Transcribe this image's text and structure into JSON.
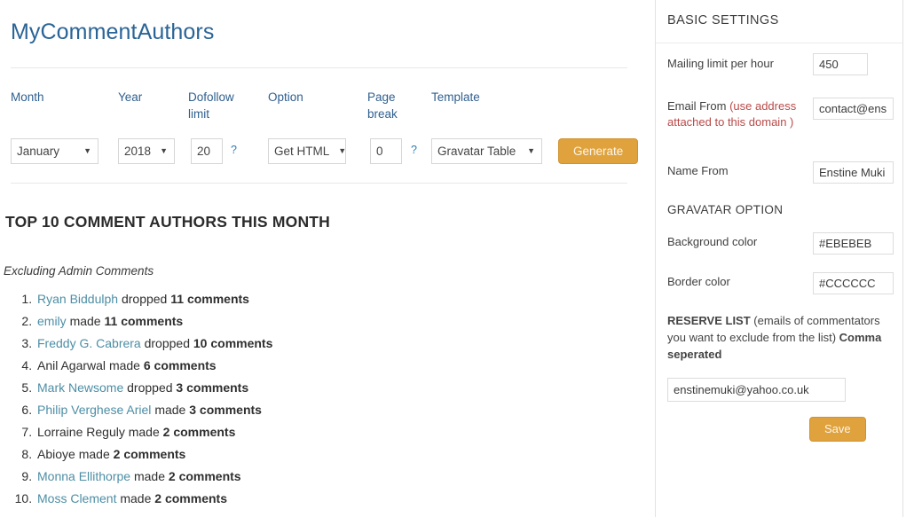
{
  "app": {
    "title": "MyCommentAuthors"
  },
  "form": {
    "labels": {
      "month": "Month",
      "year": "Year",
      "dofollow_limit": "Dofollow limit",
      "option": "Option",
      "page_break": "Page break",
      "template": "Template"
    },
    "controls": {
      "month_value": "January",
      "year_value": "2018",
      "dofollow_limit_value": "20",
      "dofollow_help": "?",
      "option_value": "Get HTML",
      "page_break_value": "0",
      "page_break_help": "?",
      "template_value": "Gravatar Table",
      "generate_label": "Generate"
    }
  },
  "results": {
    "heading": "TOP 10 COMMENT AUTHORS THIS MONTH",
    "note": "Excluding Admin Comments",
    "authors": [
      {
        "rank": 1,
        "name": "Ryan Biddulph",
        "is_link": true,
        "verb": "dropped",
        "count": "11",
        "unit": "comments"
      },
      {
        "rank": 2,
        "name": "emily",
        "is_link": true,
        "verb": "made",
        "count": "11",
        "unit": "comments"
      },
      {
        "rank": 3,
        "name": "Freddy G. Cabrera",
        "is_link": true,
        "verb": "dropped",
        "count": "10",
        "unit": "comments"
      },
      {
        "rank": 4,
        "name": "Anil Agarwal",
        "is_link": false,
        "verb": "made",
        "count": "6",
        "unit": "comments"
      },
      {
        "rank": 5,
        "name": "Mark Newsome",
        "is_link": true,
        "verb": "dropped",
        "count": "3",
        "unit": "comments"
      },
      {
        "rank": 6,
        "name": "Philip Verghese Ariel",
        "is_link": true,
        "verb": "made",
        "count": "3",
        "unit": "comments"
      },
      {
        "rank": 7,
        "name": "Lorraine Reguly",
        "is_link": false,
        "verb": "made",
        "count": "2",
        "unit": "comments"
      },
      {
        "rank": 8,
        "name": "Abioye",
        "is_link": false,
        "verb": "made",
        "count": "2",
        "unit": "comments"
      },
      {
        "rank": 9,
        "name": "Monna Ellithorpe",
        "is_link": true,
        "verb": "made",
        "count": "2",
        "unit": "comments"
      },
      {
        "rank": 10,
        "name": "Moss Clement",
        "is_link": true,
        "verb": "made",
        "count": "2",
        "unit": "comments"
      }
    ]
  },
  "sidebar": {
    "basic_settings_title": "BASIC SETTINGS",
    "mailing_limit_label": "Mailing limit per hour",
    "mailing_limit_value": "450",
    "email_from_label_plain": "Email From ",
    "email_from_label_red": "(use address attached to this domain )",
    "email_from_value": "contact@ens",
    "name_from_label": "Name From",
    "name_from_value": "Enstine Muki",
    "gravatar_option_title": "GRAVATAR OPTION",
    "background_color_label": "Background color",
    "background_color_value": "#EBEBEB",
    "border_color_label": "Border color",
    "border_color_value": "#CCCCCC",
    "reserve_list_strong": "RESERVE LIST",
    "reserve_list_text": " (emails of commentators you want to exclude from the list) ",
    "reserve_list_strong2": "Comma seperated",
    "reserve_list_value": "enstinemuki@yahoo.co.uk",
    "save_label": "Save"
  },
  "colors": {
    "title_blue": "#2a6496",
    "label_blue": "#2f5f8f",
    "link_teal": "#4d8ea5",
    "accent_gold": "#dfa23d",
    "warn_red": "#b94a48"
  }
}
